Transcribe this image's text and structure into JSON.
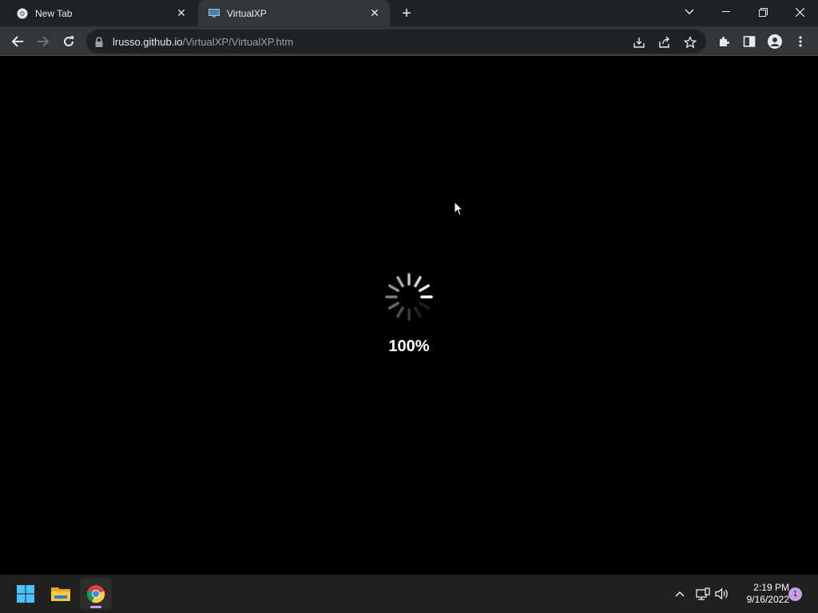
{
  "browser": {
    "tabs": [
      {
        "title": "New Tab",
        "favicon": "chrome-icon"
      },
      {
        "title": "VirtualXP",
        "favicon": "monitor-icon"
      }
    ],
    "url": {
      "host": "lrusso.github.io",
      "path": "/VirtualXP/VirtualXP.htm"
    }
  },
  "page": {
    "loading_percent": "100%",
    "progress": 1.0
  },
  "taskbar": {
    "apps": [
      "windows-start-icon",
      "file-explorer-icon",
      "chrome-icon"
    ],
    "clock": {
      "time": "2:19 PM",
      "date": "9/16/2022"
    },
    "notification_count": "1"
  },
  "colors": {
    "tabstrip": "#202124",
    "toolbar": "#35363a",
    "accent": "#c7a0e8"
  }
}
